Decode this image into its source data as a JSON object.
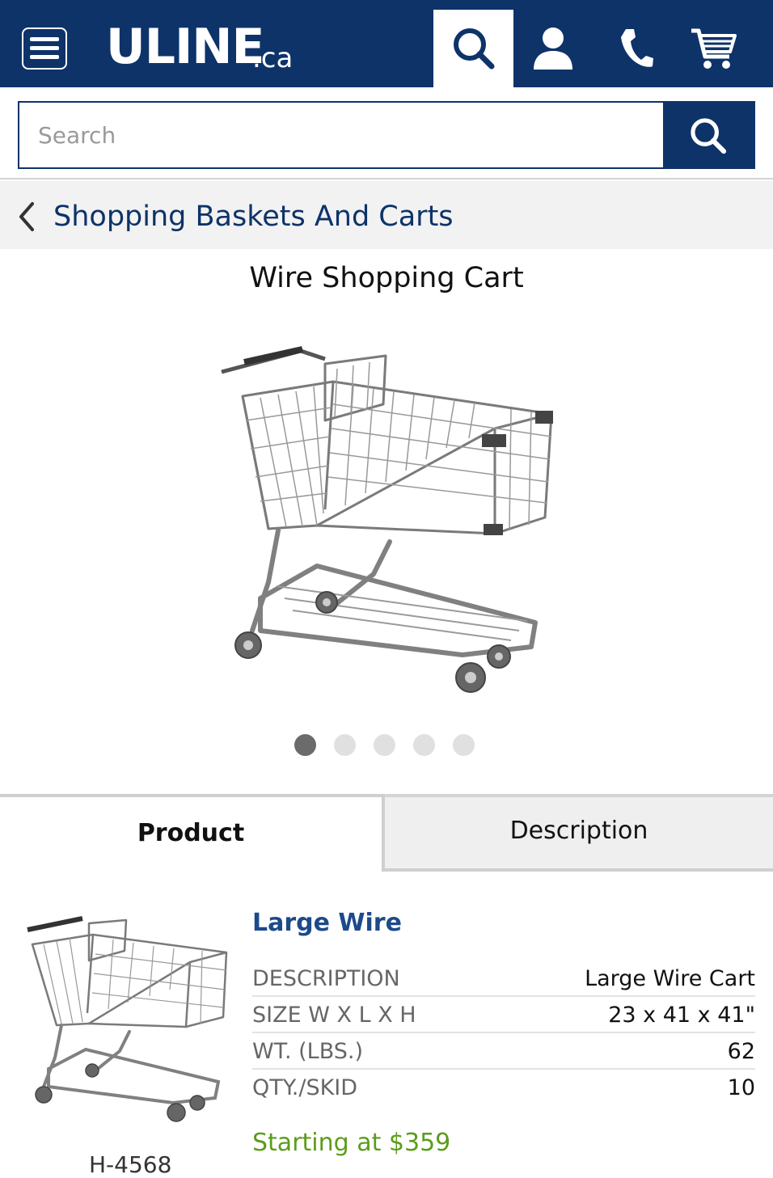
{
  "header": {
    "logo_text": "ULINE",
    "logo_suffix": ".ca",
    "brand_color": "#0d3369",
    "icons": [
      "menu-icon",
      "search-icon",
      "account-icon",
      "phone-icon",
      "cart-icon"
    ]
  },
  "search": {
    "placeholder": "Search",
    "value": ""
  },
  "breadcrumb": {
    "label": "Shopping Baskets And Carts"
  },
  "product": {
    "title": "Wire Shopping Cart",
    "carousel": {
      "total": 5,
      "active_index": 0
    }
  },
  "tabs": [
    {
      "label": "Product",
      "active": true
    },
    {
      "label": "Description",
      "active": false
    }
  ],
  "item": {
    "model_name": "Large Wire",
    "item_number": "H-4568",
    "specs": [
      {
        "label": "DESCRIPTION",
        "value": "Large Wire Cart"
      },
      {
        "label": "SIZE W X L X H",
        "value": "23 x 41 x 41\""
      },
      {
        "label": "WT. (LBS.)",
        "value": "62"
      },
      {
        "label": "QTY./SKID",
        "value": "10"
      }
    ],
    "price_text": "Starting at $359",
    "price_color": "#5d9c1c"
  }
}
